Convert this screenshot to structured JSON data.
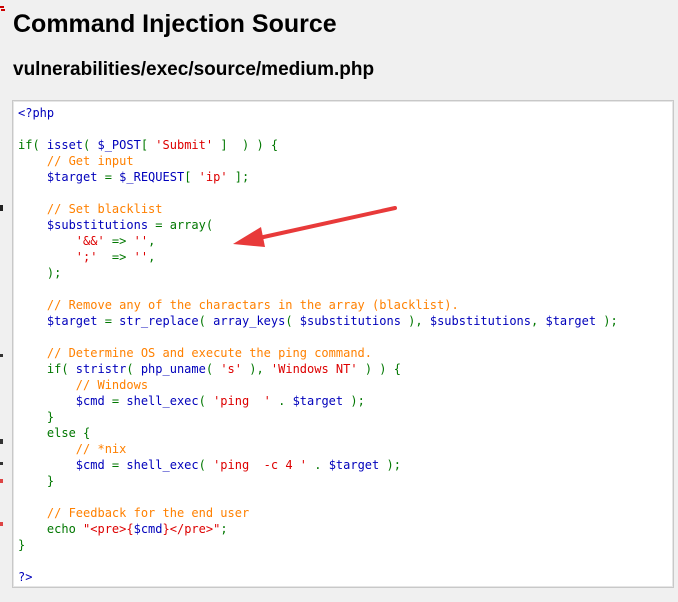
{
  "page": {
    "title": "Command Injection Source",
    "file_path": "vulnerabilities/exec/source/medium.php"
  },
  "source": {
    "lines": [
      [
        {
          "t": "<?php",
          "c": "v"
        }
      ],
      [],
      [
        {
          "t": "if( ",
          "c": "k"
        },
        {
          "t": "isset",
          "c": "v"
        },
        {
          "t": "( ",
          "c": "k"
        },
        {
          "t": "$_POST",
          "c": "v"
        },
        {
          "t": "[ ",
          "c": "k"
        },
        {
          "t": "'Submit'",
          "c": "s"
        },
        {
          "t": " ]  ) ) {",
          "c": "k"
        }
      ],
      [
        {
          "t": "    // Get input",
          "c": "c"
        }
      ],
      [
        {
          "t": "    $target ",
          "c": "v"
        },
        {
          "t": "= ",
          "c": "k"
        },
        {
          "t": "$_REQUEST",
          "c": "v"
        },
        {
          "t": "[ ",
          "c": "k"
        },
        {
          "t": "'ip'",
          "c": "s"
        },
        {
          "t": " ];",
          "c": "k"
        }
      ],
      [],
      [
        {
          "t": "    // Set blacklist",
          "c": "c"
        }
      ],
      [
        {
          "t": "    $substitutions ",
          "c": "v"
        },
        {
          "t": "= array(",
          "c": "k"
        }
      ],
      [
        {
          "t": "        ",
          "c": "k"
        },
        {
          "t": "'&&'",
          "c": "s"
        },
        {
          "t": " => ",
          "c": "k"
        },
        {
          "t": "''",
          "c": "s"
        },
        {
          "t": ",",
          "c": "k"
        }
      ],
      [
        {
          "t": "        ",
          "c": "k"
        },
        {
          "t": "';'",
          "c": "s"
        },
        {
          "t": "  => ",
          "c": "k"
        },
        {
          "t": "''",
          "c": "s"
        },
        {
          "t": ",",
          "c": "k"
        }
      ],
      [
        {
          "t": "    );",
          "c": "k"
        }
      ],
      [],
      [
        {
          "t": "    // Remove any of the charactars in the array (blacklist).",
          "c": "c"
        }
      ],
      [
        {
          "t": "    $target ",
          "c": "v"
        },
        {
          "t": "= ",
          "c": "k"
        },
        {
          "t": "str_replace",
          "c": "v"
        },
        {
          "t": "( ",
          "c": "k"
        },
        {
          "t": "array_keys",
          "c": "v"
        },
        {
          "t": "( ",
          "c": "k"
        },
        {
          "t": "$substitutions ",
          "c": "v"
        },
        {
          "t": "), ",
          "c": "k"
        },
        {
          "t": "$substitutions",
          "c": "v"
        },
        {
          "t": ", ",
          "c": "k"
        },
        {
          "t": "$target ",
          "c": "v"
        },
        {
          "t": ");",
          "c": "k"
        }
      ],
      [],
      [
        {
          "t": "    // Determine OS and execute the ping command.",
          "c": "c"
        }
      ],
      [
        {
          "t": "    if( ",
          "c": "k"
        },
        {
          "t": "stristr",
          "c": "v"
        },
        {
          "t": "( ",
          "c": "k"
        },
        {
          "t": "php_uname",
          "c": "v"
        },
        {
          "t": "( ",
          "c": "k"
        },
        {
          "t": "'s'",
          "c": "s"
        },
        {
          "t": " ), ",
          "c": "k"
        },
        {
          "t": "'Windows NT'",
          "c": "s"
        },
        {
          "t": " ) ) {",
          "c": "k"
        }
      ],
      [
        {
          "t": "        // Windows",
          "c": "c"
        }
      ],
      [
        {
          "t": "        $cmd ",
          "c": "v"
        },
        {
          "t": "= ",
          "c": "k"
        },
        {
          "t": "shell_exec",
          "c": "v"
        },
        {
          "t": "( ",
          "c": "k"
        },
        {
          "t": "'ping  '",
          "c": "s"
        },
        {
          "t": " . ",
          "c": "k"
        },
        {
          "t": "$target ",
          "c": "v"
        },
        {
          "t": ");",
          "c": "k"
        }
      ],
      [
        {
          "t": "    }",
          "c": "k"
        }
      ],
      [
        {
          "t": "    else {",
          "c": "k"
        }
      ],
      [
        {
          "t": "        // *nix",
          "c": "c"
        }
      ],
      [
        {
          "t": "        $cmd ",
          "c": "v"
        },
        {
          "t": "= ",
          "c": "k"
        },
        {
          "t": "shell_exec",
          "c": "v"
        },
        {
          "t": "( ",
          "c": "k"
        },
        {
          "t": "'ping  -c 4 '",
          "c": "s"
        },
        {
          "t": " . ",
          "c": "k"
        },
        {
          "t": "$target ",
          "c": "v"
        },
        {
          "t": ");",
          "c": "k"
        }
      ],
      [
        {
          "t": "    }",
          "c": "k"
        }
      ],
      [],
      [
        {
          "t": "    // Feedback for the end user",
          "c": "c"
        }
      ],
      [
        {
          "t": "    echo ",
          "c": "k"
        },
        {
          "t": "\"<pre>{",
          "c": "s"
        },
        {
          "t": "$cmd",
          "c": "v"
        },
        {
          "t": "}</pre>\"",
          "c": "s"
        },
        {
          "t": ";",
          "c": "k"
        }
      ],
      [
        {
          "t": "}",
          "c": "k"
        }
      ],
      [],
      [
        {
          "t": "?>",
          "c": "v"
        }
      ]
    ]
  },
  "colors": {
    "default": "#0000bb",
    "keyword": "#007700",
    "string": "#dd0000",
    "comment": "#ff8000",
    "annotation_arrow": "#e83a3a"
  },
  "icons": {
    "annotation": "red-arrow-icon"
  }
}
